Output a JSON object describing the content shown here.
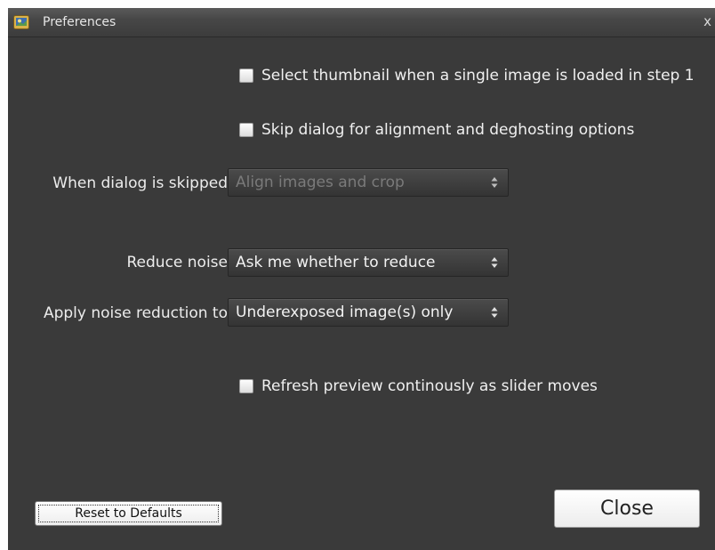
{
  "window": {
    "title": "Preferences",
    "close_glyph": "x"
  },
  "options": {
    "select_thumbnail": {
      "label": "Select thumbnail when a single image is loaded in step 1",
      "checked": false
    },
    "skip_dialog": {
      "label": "Skip dialog for alignment and deghosting options",
      "checked": false
    },
    "when_skipped": {
      "label": "When dialog is skipped",
      "value": "Align images and crop",
      "enabled": false
    },
    "reduce_noise": {
      "label": "Reduce noise",
      "value": "Ask me whether to reduce"
    },
    "apply_noise_to": {
      "label": "Apply noise reduction to",
      "value": "Underexposed image(s) only"
    },
    "refresh_preview": {
      "label": "Refresh preview continously as slider moves",
      "checked": false
    }
  },
  "buttons": {
    "reset": "Reset to Defaults",
    "close": "Close"
  },
  "icons": {
    "app": "photo-app-icon",
    "select_arrows": "up-down-arrows-icon"
  }
}
